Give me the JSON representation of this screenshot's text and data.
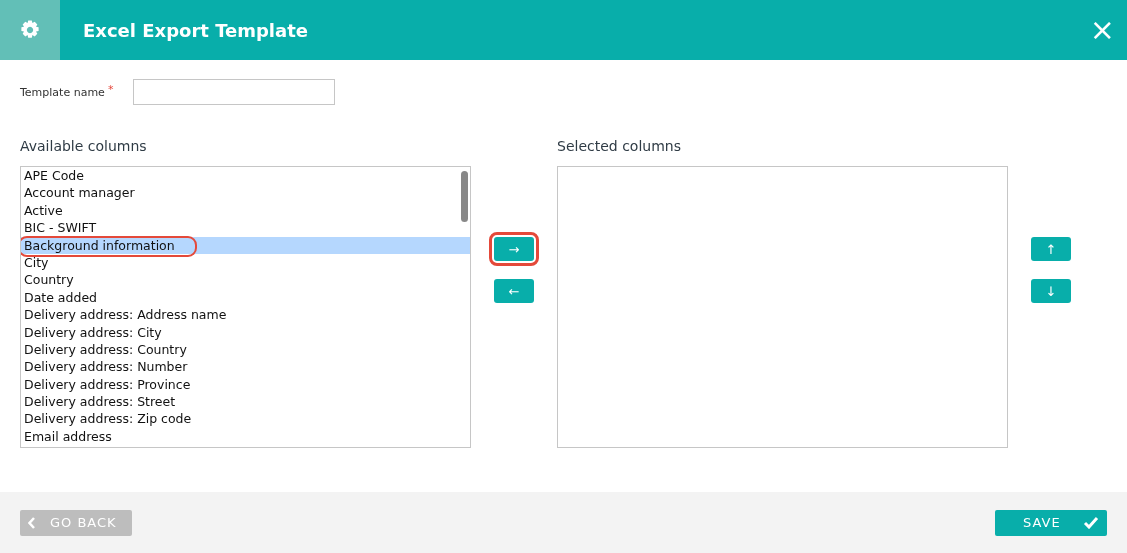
{
  "window": {
    "title": "Excel Export Template",
    "close": "×"
  },
  "template_name": {
    "label": "Template name",
    "required_mark": "*"
  },
  "available_columns": {
    "title": "Available columns",
    "items": [
      {
        "label": "APE Code",
        "selected": false,
        "annotated": false
      },
      {
        "label": "Account manager",
        "selected": false,
        "annotated": false
      },
      {
        "label": "Active",
        "selected": false,
        "annotated": false
      },
      {
        "label": "BIC - SWIFT",
        "selected": false,
        "annotated": false
      },
      {
        "label": "Background information",
        "selected": true,
        "annotated": true
      },
      {
        "label": "City",
        "selected": false,
        "annotated": false
      },
      {
        "label": "Country",
        "selected": false,
        "annotated": false
      },
      {
        "label": "Date added",
        "selected": false,
        "annotated": false
      },
      {
        "label": "Delivery address: Address name",
        "selected": false,
        "annotated": false
      },
      {
        "label": "Delivery address: City",
        "selected": false,
        "annotated": false
      },
      {
        "label": "Delivery address: Country",
        "selected": false,
        "annotated": false
      },
      {
        "label": "Delivery address: Number",
        "selected": false,
        "annotated": false
      },
      {
        "label": "Delivery address: Province",
        "selected": false,
        "annotated": false
      },
      {
        "label": "Delivery address: Street",
        "selected": false,
        "annotated": false
      },
      {
        "label": "Delivery address: Zip code",
        "selected": false,
        "annotated": false
      },
      {
        "label": "Email address",
        "selected": false,
        "annotated": false
      }
    ]
  },
  "transfer_buttons": [
    {
      "symbol": "→",
      "annotated": true
    },
    {
      "symbol": "←",
      "annotated": false
    }
  ],
  "selected_columns": {
    "title": "Selected columns"
  },
  "order_buttons": [
    {
      "symbol": "↑"
    },
    {
      "symbol": "↓"
    }
  ],
  "footer": {
    "back_button": "GO BACK",
    "save_button": "SAVE"
  }
}
